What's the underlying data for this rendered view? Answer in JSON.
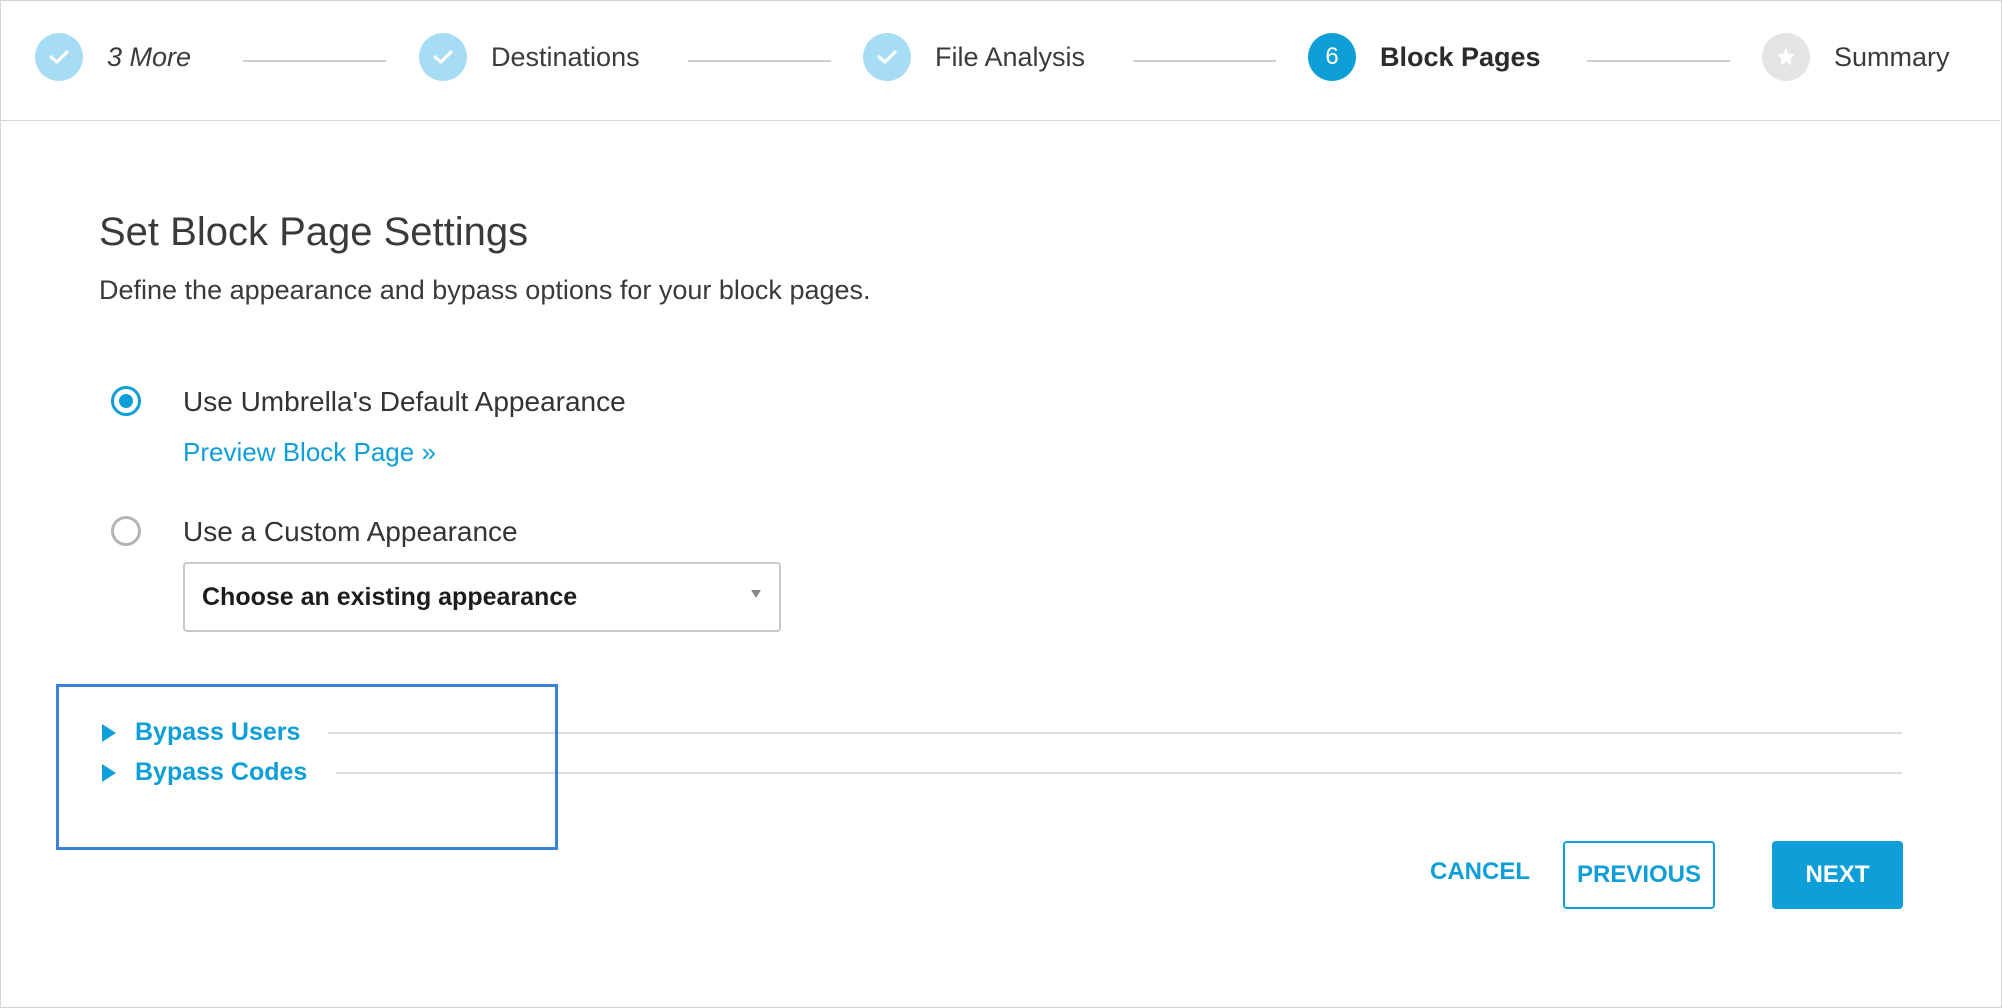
{
  "stepper": {
    "steps": [
      {
        "label": "3 More",
        "state": "done",
        "icon": "check-icon"
      },
      {
        "label": "Destinations",
        "state": "done",
        "icon": "check-icon"
      },
      {
        "label": "File Analysis",
        "state": "done",
        "icon": "check-icon"
      },
      {
        "label": "Block Pages",
        "state": "active",
        "number": "6"
      },
      {
        "label": "Summary",
        "state": "pending",
        "icon": "star-icon"
      }
    ]
  },
  "main": {
    "title": "Set Block Page Settings",
    "subtitle": "Define the appearance and bypass options for your block pages.",
    "options": [
      {
        "label": "Use Umbrella's Default Appearance",
        "selected": true,
        "link": "Preview Block Page »"
      },
      {
        "label": "Use a Custom Appearance",
        "selected": false
      }
    ],
    "appearance_select": {
      "value": "Choose an existing appearance"
    }
  },
  "bypass": {
    "items": [
      "Bypass Users",
      "Bypass Codes"
    ]
  },
  "actions": {
    "cancel": "CANCEL",
    "previous": "PREVIOUS",
    "next": "NEXT"
  },
  "colors": {
    "accent": "#0f9fd8",
    "done_step": "#a6dcf4",
    "highlight_box": "#3a82d8"
  }
}
